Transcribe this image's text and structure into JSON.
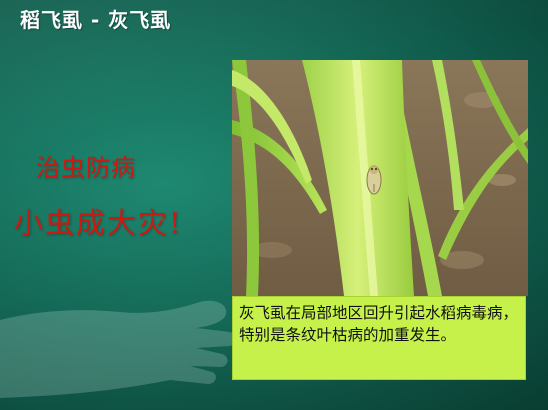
{
  "slide": {
    "title": "稻飞虱 - 灰飞虱",
    "slogan_line1": "治虫防病",
    "slogan_line2": "小虫成大灾!",
    "caption": "灰飞虱在局部地区回升引起水稻病毒病，特别是条纹叶枯病的加重发生。"
  },
  "colors": {
    "background": "#16705c",
    "slogan": "#cc1a12",
    "caption_bg": "#c6f14a"
  }
}
